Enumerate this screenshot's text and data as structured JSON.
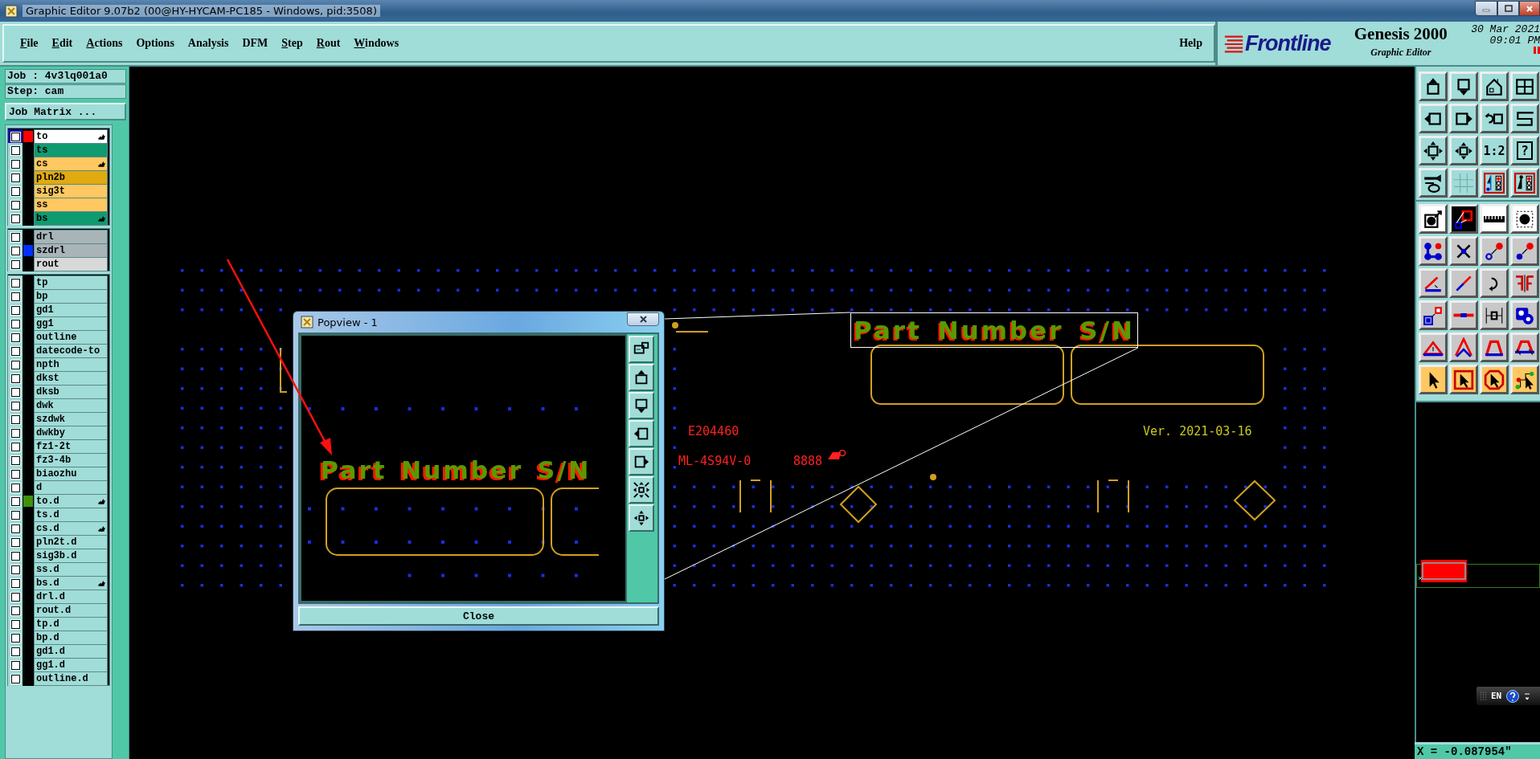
{
  "window": {
    "title": "Graphic Editor 9.07b2 (00@HY-HYCAM-PC185 - Windows, pid:3508)"
  },
  "menu": [
    {
      "label": "File",
      "underline_first": true
    },
    {
      "label": "Edit",
      "underline_first": true
    },
    {
      "label": "Actions",
      "underline_first": true
    },
    {
      "label": "Options",
      "underline_first": false
    },
    {
      "label": "Analysis",
      "underline_first": false
    },
    {
      "label": "DFM",
      "underline_first": false
    },
    {
      "label": "Step",
      "underline_first": true
    },
    {
      "label": "Rout",
      "underline_first": true
    },
    {
      "label": "Windows",
      "underline_first": true
    }
  ],
  "help_menu": {
    "label": "Help"
  },
  "brand": {
    "logo": "Frontline",
    "product": "Genesis 2000",
    "subtitle": "Graphic Editor",
    "date": "30 Mar 2021",
    "time": "09:01 PM"
  },
  "job": {
    "job": "Job : 4v3lq001a0",
    "step": "Step: cam",
    "matrix_button": "Job Matrix ..."
  },
  "layer_groups": [
    {
      "layers": [
        {
          "name": "to",
          "color": "#ffffff",
          "work_layer": true,
          "swatch": {
            "color": "#ff0000"
          },
          "hand": true
        },
        {
          "name": "ts",
          "color": "#109a70",
          "work_layer": false,
          "hand": false
        },
        {
          "name": "cs",
          "color": "#ffc860",
          "work_layer": false,
          "hand": true
        },
        {
          "name": "pln2b",
          "color": "#e0aa10",
          "work_layer": false,
          "hand": false
        },
        {
          "name": "sig3t",
          "color": "#ffc860",
          "work_layer": false,
          "hand": false
        },
        {
          "name": "ss",
          "color": "#ffc860",
          "work_layer": false,
          "hand": false
        },
        {
          "name": "bs",
          "color": "#109a70",
          "work_layer": false,
          "hand": true
        }
      ]
    },
    {
      "layers": [
        {
          "name": "drl",
          "color": "#a8b4b8",
          "work_layer": false,
          "hand": false
        },
        {
          "name": "szdrl",
          "color": "#a8b4b8",
          "work_layer": false,
          "swatch": {
            "color": "#0030ff"
          },
          "hand": false
        },
        {
          "name": "rout",
          "color": "#d8d8d8",
          "work_layer": false,
          "hand": false
        }
      ]
    },
    {
      "layers": [
        {
          "name": "tp",
          "color": "#a0dcd8",
          "work_layer": false,
          "hand": false
        },
        {
          "name": "bp",
          "color": "#a0dcd8",
          "work_layer": false,
          "hand": false
        },
        {
          "name": "gd1",
          "color": "#a0dcd8",
          "work_layer": false,
          "hand": false
        },
        {
          "name": "gg1",
          "color": "#a0dcd8",
          "work_layer": false,
          "hand": false
        },
        {
          "name": "outline",
          "color": "#a0dcd8",
          "work_layer": false,
          "hand": false
        },
        {
          "name": "datecode-to",
          "color": "#a0dcd8",
          "work_layer": false,
          "hand": false
        },
        {
          "name": "npth",
          "color": "#a0dcd8",
          "work_layer": false,
          "hand": false
        },
        {
          "name": "dkst",
          "color": "#a0dcd8",
          "work_layer": false,
          "hand": false
        },
        {
          "name": "dksb",
          "color": "#a0dcd8",
          "work_layer": false,
          "hand": false
        },
        {
          "name": "dwk",
          "color": "#a0dcd8",
          "work_layer": false,
          "hand": false
        },
        {
          "name": "szdwk",
          "color": "#a0dcd8",
          "work_layer": false,
          "hand": false
        },
        {
          "name": "dwkby",
          "color": "#a0dcd8",
          "work_layer": false,
          "hand": false
        },
        {
          "name": "fz1-2t",
          "color": "#a0dcd8",
          "work_layer": false,
          "hand": false
        },
        {
          "name": "fz3-4b",
          "color": "#a0dcd8",
          "work_layer": false,
          "hand": false
        },
        {
          "name": "biaozhu",
          "color": "#a0dcd8",
          "work_layer": false,
          "hand": false
        },
        {
          "name": "d",
          "color": "#a0dcd8",
          "work_layer": false,
          "hand": false
        },
        {
          "name": "to.d",
          "color": "#a0dcd8",
          "work_layer": false,
          "swatch": {
            "color": "#40900a"
          },
          "hand": true
        },
        {
          "name": "ts.d",
          "color": "#a0dcd8",
          "work_layer": false,
          "hand": false
        },
        {
          "name": "cs.d",
          "color": "#a0dcd8",
          "work_layer": false,
          "hand": true
        },
        {
          "name": "pln2t.d",
          "color": "#a0dcd8",
          "work_layer": false,
          "hand": false
        },
        {
          "name": "sig3b.d",
          "color": "#a0dcd8",
          "work_layer": false,
          "hand": false
        },
        {
          "name": "ss.d",
          "color": "#a0dcd8",
          "work_layer": false,
          "hand": false
        },
        {
          "name": "bs.d",
          "color": "#a0dcd8",
          "work_layer": false,
          "hand": true
        },
        {
          "name": "drl.d",
          "color": "#a0dcd8",
          "work_layer": false,
          "hand": false
        },
        {
          "name": "rout.d",
          "color": "#a0dcd8",
          "work_layer": false,
          "hand": false
        },
        {
          "name": "tp.d",
          "color": "#a0dcd8",
          "work_layer": false,
          "hand": false
        },
        {
          "name": "bp.d",
          "color": "#a0dcd8",
          "work_layer": false,
          "hand": false
        },
        {
          "name": "gd1.d",
          "color": "#a0dcd8",
          "work_layer": false,
          "hand": false
        },
        {
          "name": "gg1.d",
          "color": "#a0dcd8",
          "work_layer": false,
          "hand": false
        },
        {
          "name": "outline.d",
          "color": "#a0dcd8",
          "work_layer": false,
          "hand": false
        }
      ]
    }
  ],
  "toolbar_labels": [
    "1:2",
    "?"
  ],
  "canvas": {
    "zoom_label": "Part Number S/N",
    "texts": [
      {
        "text": "E204460",
        "color": "#ff2020"
      },
      {
        "text": "ML-4S94V-0",
        "color": "#ff2020"
      },
      {
        "text": "8888",
        "color": "#ff2020"
      },
      {
        "text": "Ver. 2021-03-16",
        "color": "#c8c820"
      }
    ]
  },
  "popview": {
    "title": "Popview - 1",
    "label": "Part Number S/N",
    "close": "Close"
  },
  "language_bar": {
    "label": "EN"
  },
  "status": {
    "coordinate": "X = -0.087954\""
  }
}
